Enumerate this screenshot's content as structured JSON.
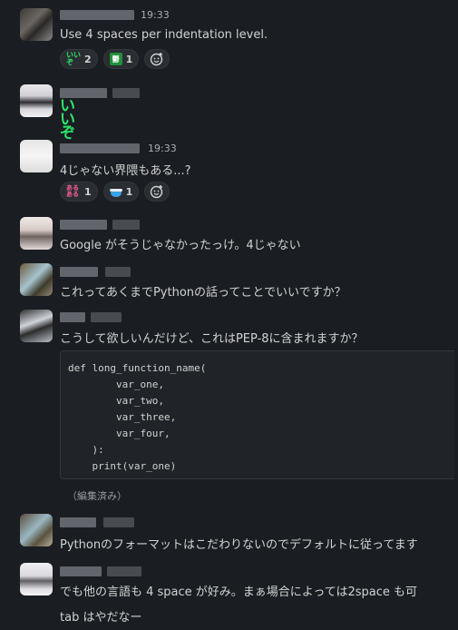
{
  "messages": [
    {
      "time": "19:33",
      "text": "Use 4 spaces per indentation level.",
      "reactions": [
        {
          "emoji": "iiz-icon",
          "count": "2"
        },
        {
          "emoji": "green-emoji-icon",
          "count": "1"
        }
      ]
    },
    {
      "emoji_text": "いいぞ"
    },
    {
      "time": "19:33",
      "text": "4じゃない界隈もある...?",
      "reactions": [
        {
          "emoji": "aruaru-icon",
          "count": "1"
        },
        {
          "emoji": "cup-icon",
          "count": "1"
        }
      ]
    },
    {
      "text": "Google がそうじゃなかったっけ。4じゃない"
    },
    {
      "text": "これってあくまでPythonの話ってことでいいですか？"
    },
    {
      "text": "こうして欲しいんだけど、これはPEP-8に含まれますか？",
      "code": "def long_function_name(\n        var_one,\n        var_two,\n        var_three,\n        var_four,\n    ):\n    print(var_one)",
      "edited": "（編集済み）"
    },
    {
      "text": "Pythonのフォーマットはこだわりないのでデフォルトに従ってます"
    },
    {
      "text": "でも他の言語も 4 space が好み。まぁ場合によっては2space も可",
      "text2": "tab はやだなー"
    }
  ],
  "emoji_labels": {
    "iiz": "いいぞ",
    "green": "鬱",
    "aruaru": "あるある"
  },
  "colors": {
    "background": "#1a1d21",
    "text": "#d1d2d3",
    "reaction_bg": "#2a2d31"
  }
}
